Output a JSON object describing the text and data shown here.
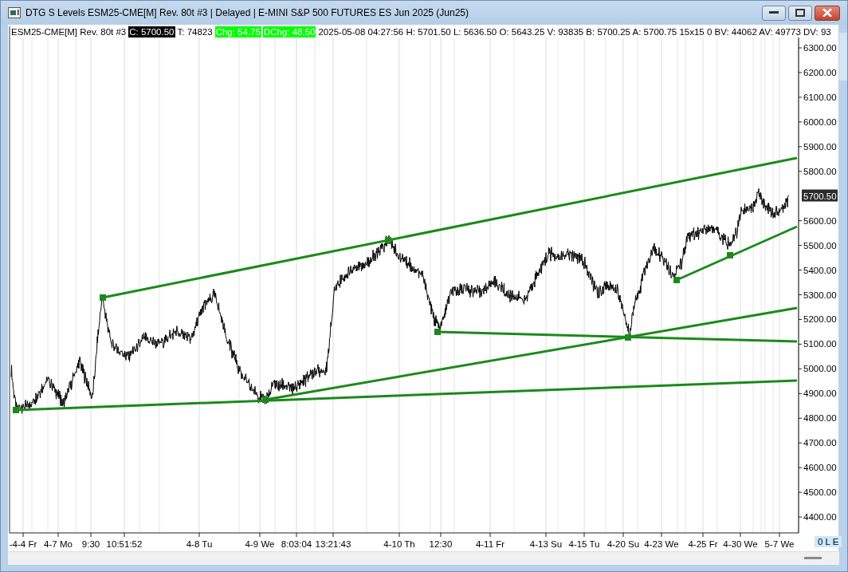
{
  "window": {
    "title": "DTG S Levels ESM25-CME[M]  Rev. 80t #3 | Delayed | E-MINI S&P 500 FUTURES ES Jun 2025 (Jun25)"
  },
  "info_bar": [
    {
      "text": "ESM25-CME[M]  Rev. 80t #3"
    },
    {
      "text": "C: 5700.50",
      "color": "#000000"
    },
    {
      "text": "T: 74823"
    },
    {
      "text": "Chg: 54.75",
      "color": "#00ff00"
    },
    {
      "text": "DChg: 48.50",
      "color": "#00ff00"
    },
    {
      "text": "2025-05-08 04:27:56 H: 5701.50 L: 5636.50 O: 5643.25 V: 93835 B: 5700.25 A: 5700.75 15x15 0 BV: 44062 AV: 49773 DV: 93"
    }
  ],
  "y_axis": {
    "ticks": [
      "6300.00",
      "6200.00",
      "6100.00",
      "6000.00",
      "5900.00",
      "5800.00",
      "5600.00",
      "5500.00",
      "5400.00",
      "5300.00",
      "5200.00",
      "5100.00",
      "5000.00",
      "4900.00",
      "4800.00",
      "4700.00",
      "4600.00",
      "4500.00",
      "4400.00"
    ],
    "current_price": "5700.50"
  },
  "x_axis": {
    "labels": [
      "-4-4 Fr",
      "4-7 Mo",
      "9:30",
      "10:51:52",
      "4-8 Tu",
      "4-9 We",
      "8:03:04",
      "13:21:43",
      "4-10 Th",
      "12:30",
      "4-11 Fr",
      "4-13 Su",
      "4-15 Tu",
      "4-20 Su",
      "4-23 We",
      "4-25 Fr",
      "4-30 We",
      "5-7 We"
    ]
  },
  "status": {
    "label": "0 L E"
  }
}
